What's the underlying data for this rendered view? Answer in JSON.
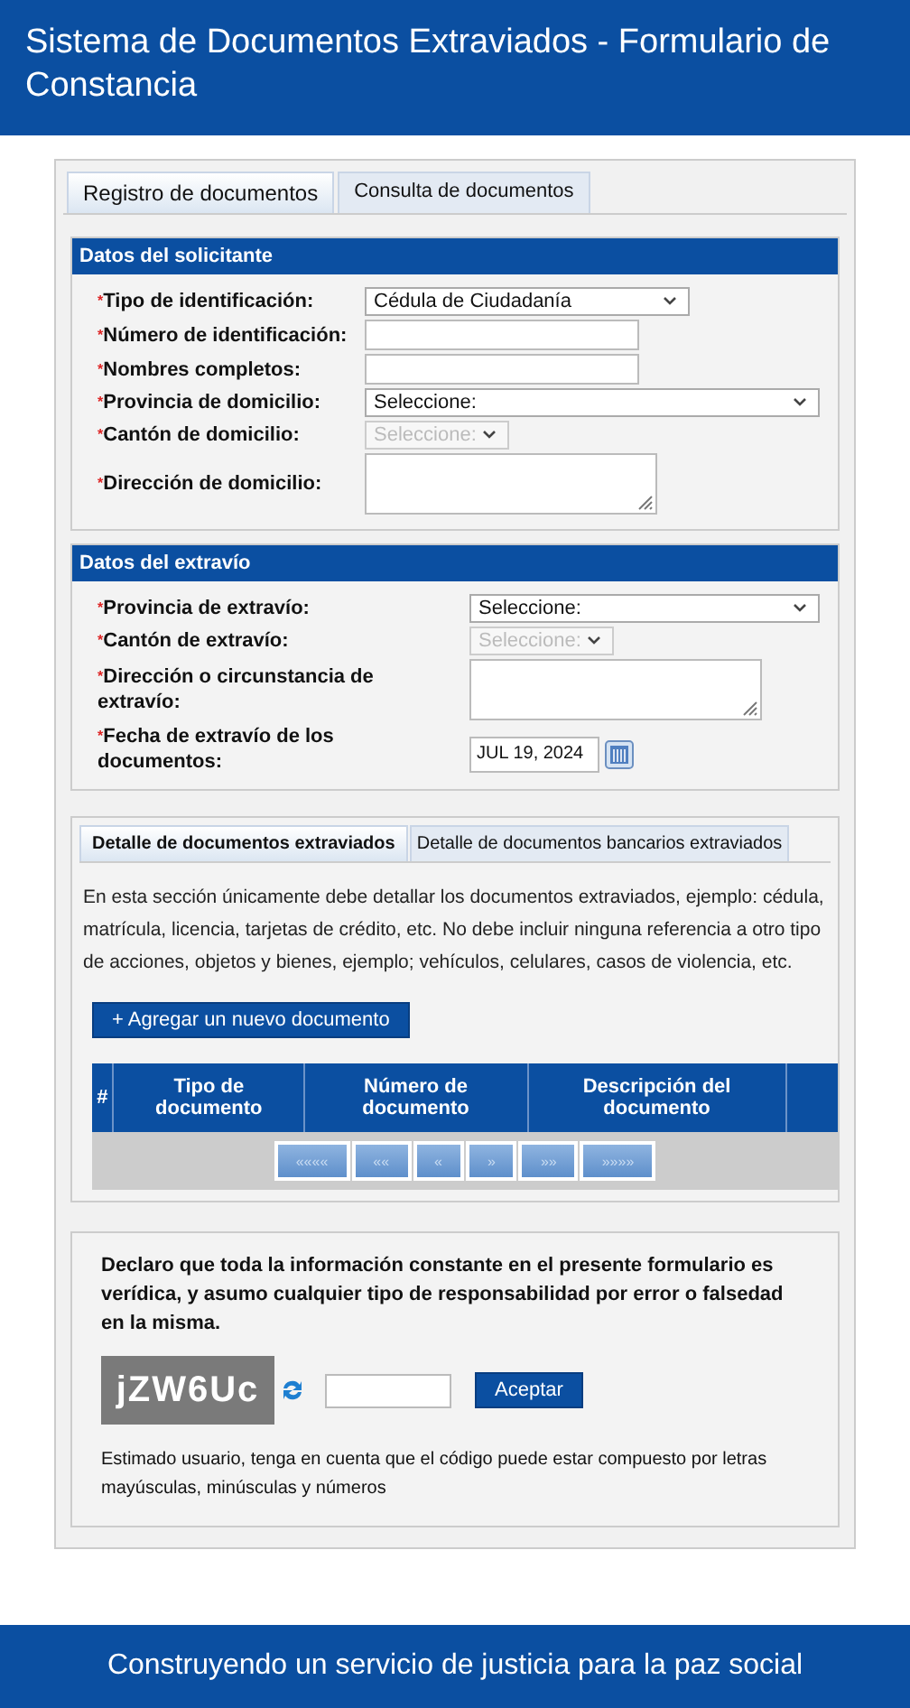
{
  "header": {
    "title": "Sistema de Documentos Extraviados - Formulario de Constancia"
  },
  "tabs": [
    {
      "label": "Registro de documentos",
      "selected": true
    },
    {
      "label": "Consulta de documentos",
      "selected": false
    }
  ],
  "sections": [
    {
      "title": "Datos del solicitante",
      "fields": [
        {
          "kind": "select",
          "label": "Tipo de identificación:",
          "required_mark": "*",
          "value": "Cédula de Ciudadanía",
          "disabled": false
        },
        {
          "kind": "input",
          "label": "Número de identificación:",
          "required_mark": "*"
        },
        {
          "kind": "input",
          "label": "Nombres completos:",
          "required_mark": "*"
        },
        {
          "kind": "select",
          "label": "Provincia de domicilio:",
          "required_mark": "*",
          "value": "Seleccione:",
          "disabled": false
        },
        {
          "kind": "select",
          "label": "Cantón de domicilio:",
          "required_mark": "*",
          "value": "Seleccione:",
          "disabled": true
        },
        {
          "kind": "textarea",
          "label": "Dirección de domicilio:",
          "required_mark": "*"
        }
      ]
    },
    {
      "title": "Datos del extravío",
      "fields": [
        {
          "kind": "select",
          "label": "Provincia de extravío:",
          "required_mark": "*",
          "value": "Seleccione:",
          "disabled": false
        },
        {
          "kind": "select",
          "label": "Cantón de extravío:",
          "required_mark": "*",
          "value": "Seleccione:",
          "disabled": true
        },
        {
          "kind": "textarea",
          "label": "Dirección o circunstancia de extravío:",
          "required_mark": "*"
        },
        {
          "kind": "date",
          "label": "Fecha de extravío de los documentos:",
          "required_mark": "*",
          "value": "JUL 19, 2024"
        }
      ]
    }
  ],
  "detail_tabs": [
    {
      "label": "Detalle de documentos extraviados",
      "selected": true
    },
    {
      "label": "Detalle de documentos bancarios extraviados",
      "selected": false
    }
  ],
  "detail_note": "En esta sección únicamente debe detallar los documentos extraviados, ejemplo: cédula, matrícula, licencia, tarjetas de crédito, etc. No debe incluir ninguna referencia a otro tipo de acciones, objetos y bienes, ejemplo; vehículos, celulares, casos de violencia, etc.",
  "add_button": "+ Agregar un nuevo documento",
  "table": {
    "columns": [
      "#",
      "Tipo de documento",
      "Número de documento",
      "Descripción del documento"
    ]
  },
  "pager": [
    {
      "label": "««««",
      "disabled": true
    },
    {
      "label": "««",
      "disabled": true
    },
    {
      "label": "«",
      "disabled": true
    },
    {
      "label": "»",
      "disabled": true
    },
    {
      "label": "»»",
      "disabled": true
    },
    {
      "label": "»»»»",
      "disabled": true
    }
  ],
  "declaration": {
    "text": "Declaro que toda la información constante en el presente formulario es verídica, y asumo cualquier tipo de responsabilidad por error o falsedad en la misma.",
    "captcha": "jZW6Uc",
    "submit": "Aceptar",
    "note": "Estimado usuario, tenga en cuenta que el código puede estar compuesto por letras mayúsculas, minúsculas y números"
  },
  "footer": {
    "text": "Construyendo un servicio de justicia para la paz social"
  }
}
